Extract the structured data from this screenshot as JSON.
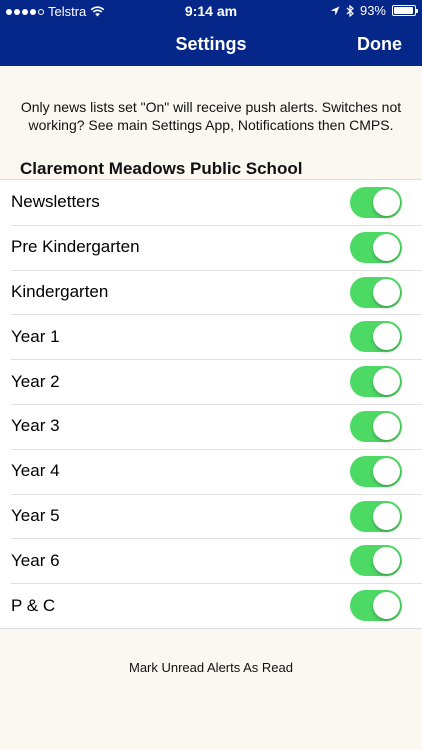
{
  "status_bar": {
    "carrier": "Telstra",
    "time": "9:14 am",
    "battery": "93%",
    "battery_level": 0.93
  },
  "nav": {
    "title": "Settings",
    "done_label": "Done"
  },
  "notice": "Only news lists set \"On\" will receive push alerts. Switches not working? See main Settings App, Notifications then CMPS.",
  "school_name": "Claremont Meadows Public School",
  "lists": [
    {
      "label": "Newsletters",
      "on": true
    },
    {
      "label": "Pre Kindergarten",
      "on": true
    },
    {
      "label": "Kindergarten",
      "on": true
    },
    {
      "label": "Year 1",
      "on": true
    },
    {
      "label": "Year 2",
      "on": true
    },
    {
      "label": "Year 3",
      "on": true
    },
    {
      "label": "Year 4",
      "on": true
    },
    {
      "label": "Year 5",
      "on": true
    },
    {
      "label": "Year 6",
      "on": true
    },
    {
      "label": "P & C",
      "on": true
    }
  ],
  "mark_read_label": "Mark Unread Alerts As Read",
  "colors": {
    "nav_background": "#06278a",
    "toggle_on": "#4cd964",
    "page_background": "#fbf8f1"
  }
}
